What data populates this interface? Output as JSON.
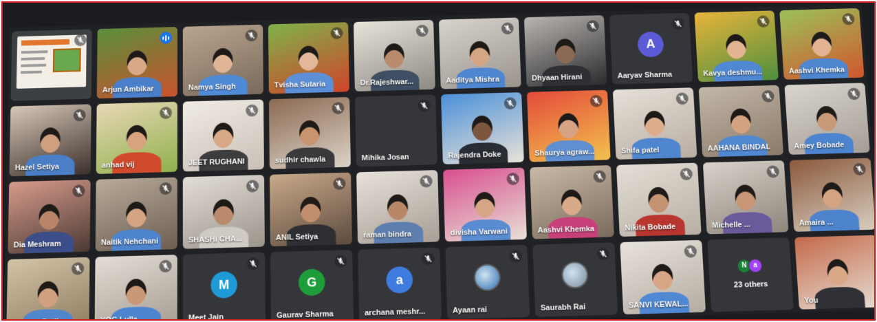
{
  "meeting": {
    "others_count_label": "23 others",
    "others_avatars": [
      {
        "initial": "N",
        "color": "#188038"
      },
      {
        "initial": "a",
        "color": "#a142f4"
      }
    ],
    "accent_speaking": "#8ab4f8"
  },
  "tiles": [
    {
      "name": "",
      "kind": "presentation",
      "mic": "muted"
    },
    {
      "name": "Arjun Ambikar",
      "kind": "video",
      "mic": "speaking",
      "c1": "#5a8f3c",
      "c2": "#c9532e",
      "skin": "#d9a887",
      "shirt": "#4a7fc9"
    },
    {
      "name": "Namya Singh",
      "kind": "video",
      "mic": "muted",
      "c1": "#b9a48e",
      "c2": "#7a6a5c",
      "skin": "#e0b596",
      "shirt": "#4f8ad6"
    },
    {
      "name": "Tvisha Sutaria",
      "kind": "video",
      "mic": "muted",
      "c1": "#7fb24a",
      "c2": "#d0442a",
      "skin": "#e3b89a",
      "shirt": "#5b90d8"
    },
    {
      "name": "Dr.Rajeshwar...",
      "kind": "video",
      "mic": "muted",
      "c1": "#e9e4da",
      "c2": "#8d8a84",
      "skin": "#b98b6c",
      "shirt": "#3e4f63"
    },
    {
      "name": "Aaditya Mishra",
      "kind": "video",
      "mic": "muted",
      "c1": "#d7d3cc",
      "c2": "#9a948d",
      "skin": "#d5a684",
      "shirt": "#4e86d1"
    },
    {
      "name": "Dhyaan Hirani",
      "kind": "video",
      "mic": "muted",
      "c1": "#b9b5b0",
      "c2": "#2b2b2e",
      "skin": "#8b6a55",
      "shirt": "#2f3035"
    },
    {
      "name": "Aaryav Sharma",
      "kind": "avatar",
      "mic": "muted",
      "initial": "A",
      "avatar_color": "#5b5bd6"
    },
    {
      "name": "Kavya deshmu...",
      "kind": "video",
      "mic": "muted",
      "c1": "#e7b43b",
      "c2": "#4f8f3e",
      "skin": "#e2b491",
      "shirt": "#5188d3"
    },
    {
      "name": "Aashvi Khemka",
      "kind": "video",
      "mic": "muted",
      "c1": "#9cc15a",
      "c2": "#d1562e",
      "skin": "#e2b393",
      "shirt": "#4e86cf"
    },
    {
      "name": "Hazel Setiya",
      "kind": "video",
      "mic": "muted",
      "c1": "#d6c7b8",
      "c2": "#3c302b",
      "skin": "#cf9f80",
      "shirt": "#4a7fc7"
    },
    {
      "name": "anhad vij",
      "kind": "video",
      "mic": "muted",
      "c1": "#e8d7b6",
      "c2": "#8fb14b",
      "skin": "#d8a27e",
      "shirt": "#d14a2b"
    },
    {
      "name": "JEET RUGHANI",
      "kind": "video",
      "mic": "muted",
      "c1": "#f0ebe5",
      "c2": "#c9c0b6",
      "skin": "#d7a988",
      "shirt": "#3d3c3f"
    },
    {
      "name": "sudhir chawla",
      "kind": "video",
      "mic": "muted",
      "c1": "#8c6a52",
      "c2": "#dcd3c8",
      "skin": "#c7946f",
      "shirt": "#3a3a3d"
    },
    {
      "name": "Mihika Josan",
      "kind": "blank",
      "mic": "muted"
    },
    {
      "name": "Rajendra Doke",
      "kind": "video",
      "mic": "muted",
      "c1": "#4a90d9",
      "c2": "#e9e2d8",
      "skin": "#7d5640",
      "shirt": "#2a2c33"
    },
    {
      "name": "Shaurya agraw...",
      "kind": "video",
      "mic": "muted",
      "c1": "#e44b3a",
      "c2": "#f2c14e",
      "skin": "#d6a484",
      "shirt": "#5f8fd0"
    },
    {
      "name": "Shifa patel",
      "kind": "video",
      "mic": "muted",
      "c1": "#e6e0d8",
      "c2": "#b8ada2",
      "skin": "#dcae8e",
      "shirt": "#4f86cf"
    },
    {
      "name": "AAHANA BINDAL",
      "kind": "video",
      "mic": "muted",
      "c1": "#c3b7a8",
      "c2": "#8a7a69",
      "skin": "#d3a281",
      "shirt": "#5088d2"
    },
    {
      "name": "Amey Bobade",
      "kind": "video",
      "mic": "muted",
      "c1": "#d9d5cf",
      "c2": "#a49d95",
      "skin": "#c99a79",
      "shirt": "#4c84cf"
    },
    {
      "name": "Dia Meshram",
      "kind": "video",
      "mic": "muted",
      "c1": "#d79b8b",
      "c2": "#4b3a34",
      "skin": "#b98467",
      "shirt": "#3c4e8a"
    },
    {
      "name": "Naitik Nehchani",
      "kind": "video",
      "mic": "muted",
      "c1": "#b8ab9a",
      "c2": "#6d5e50",
      "skin": "#d4a483",
      "shirt": "#4d84cd"
    },
    {
      "name": "SHASHI CHA...",
      "kind": "video",
      "mic": "muted",
      "c1": "#e2ddd6",
      "c2": "#9b948b",
      "skin": "#b98a6b",
      "shirt": "#cfcac4"
    },
    {
      "name": "ANIL Setiya",
      "kind": "video",
      "mic": "muted",
      "c1": "#c9a98a",
      "c2": "#5d4b3e",
      "skin": "#c18e6d",
      "shirt": "#2e2f33"
    },
    {
      "name": "raman bindra",
      "kind": "video",
      "mic": "muted",
      "c1": "#e6e1da",
      "c2": "#a79e94",
      "skin": "#b78767",
      "shirt": "#5d7fb0"
    },
    {
      "name": "divisha Varwani",
      "kind": "video",
      "mic": "muted",
      "c1": "#d94f8f",
      "c2": "#e7e0d6",
      "skin": "#d6a585",
      "shirt": "#5a8cd2"
    },
    {
      "name": "Aashvi Khemka",
      "kind": "video",
      "mic": "muted",
      "c1": "#c9b9a6",
      "c2": "#7a6a5b",
      "skin": "#d9aa8a",
      "shirt": "#c7407a"
    },
    {
      "name": "Nikita Bobade",
      "kind": "video",
      "mic": "muted",
      "c1": "#e4ded6",
      "c2": "#b8afa4",
      "skin": "#c49372",
      "shirt": "#b8362f"
    },
    {
      "name": "Michelle ...",
      "kind": "video",
      "mic": "muted",
      "c1": "#d8d2ca",
      "c2": "#8e857b",
      "skin": "#c79676",
      "shirt": "#6a5a9c"
    },
    {
      "name": "Amaira ...",
      "kind": "video",
      "mic": "muted",
      "c1": "#8b5a3c",
      "c2": "#d8cdbf",
      "skin": "#d4a382",
      "shirt": "#4c83cc"
    },
    {
      "name": "Suhana Patil",
      "kind": "video",
      "mic": "muted",
      "c1": "#d4c4a7",
      "c2": "#8e7d61",
      "skin": "#d2a080",
      "shirt": "#4f86ce"
    },
    {
      "name": "YOG Lulla",
      "kind": "video",
      "mic": "muted",
      "c1": "#e3ddd5",
      "c2": "#a59c92",
      "skin": "#c99877",
      "shirt": "#4c84cf"
    },
    {
      "name": "Meet Jain",
      "kind": "avatar",
      "mic": "muted",
      "initial": "M",
      "avatar_color": "#1e9bd7"
    },
    {
      "name": "Gaurav Sharma",
      "kind": "avatar",
      "mic": "muted",
      "initial": "G",
      "avatar_color": "#1e9e3a"
    },
    {
      "name": "archana meshr...",
      "kind": "avatar",
      "mic": "muted",
      "initial": "a",
      "avatar_color": "#3f7ce0"
    },
    {
      "name": "Ayaan rai",
      "kind": "avatar",
      "mic": "muted",
      "initial": "",
      "avatar_color": "#2f6fb0",
      "photo": true
    },
    {
      "name": "Saurabh Rai",
      "kind": "avatar",
      "mic": "muted",
      "initial": "",
      "avatar_color": "#7a8a99",
      "photo": true
    },
    {
      "name": "SANVI KEWAL...",
      "kind": "video",
      "mic": "muted",
      "c1": "#e7e2db",
      "c2": "#b4aca2",
      "skin": "#d6a686",
      "shirt": "#5089d3"
    },
    {
      "name": "",
      "kind": "others",
      "mic": "none"
    },
    {
      "name": "You",
      "kind": "video",
      "mic": "none",
      "c1": "#c46a4a",
      "c2": "#e6ddd2",
      "skin": "#d9a887",
      "shirt": "#2f3136"
    }
  ]
}
